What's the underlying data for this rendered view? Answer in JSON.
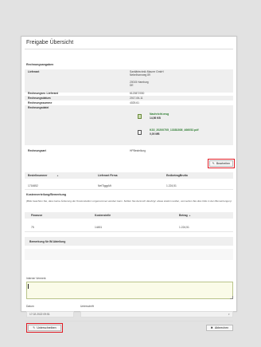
{
  "page": {
    "title": "Freigabe Übersicht"
  },
  "rechnungsangaben": {
    "heading": "Rechnungsangaben",
    "lieferant_label": "Lieferant",
    "lieferant_name": "Sanitärtechnik Maurer GmbH",
    "lieferant_street": "Nebelhornweg 89",
    "lieferant_city": "20015 Hamburg",
    "lieferant_country": "DE",
    "rechnungsnr_label": "Rechnungsnr. Lieferant",
    "rechnungsnr_value": "6123872030",
    "rechnungsdatum_label": "Rechnungsdatum",
    "rechnungsdatum_value": "2017-06-11",
    "rechnungssumme_label": "Rechnungssumme",
    "rechnungssumme_value": "4025.61",
    "dateien_label": "Rechnungsdatei",
    "file1_name": "Nachricht.msg",
    "file1_size": "14,56 KB",
    "file2_name": "K33_20200705_13381808_466052.pdf",
    "file2_size": "0,00 MB",
    "rechnungsart_label": "Rechnungsart",
    "rechnungsart_value": "HPBestellung"
  },
  "edit_button": "Bearbeiten",
  "bestell_table": {
    "headers": [
      "Bestellnummer",
      "Lieferant Firma",
      "EndbetragBrutto"
    ],
    "row": [
      "1716652",
      "NetTiggyMt",
      "1.224,51"
    ]
  },
  "kosten": {
    "heading": "Kostenverteilung/Bemerkung",
    "hint": "(Bitte beachten Sie, dass keine Änderung der Kostenstellen vorgenommen werden kann. Sollten Sie dennoch diesbzgl. etwas ändern wollen, vermerken Sie dies bitte in den Bemerkungen)",
    "headers": [
      "Finanzor",
      "Kostenstelle",
      "Betrag"
    ],
    "row": [
      "75",
      "14451",
      "1.224,51"
    ]
  },
  "bemerkung": {
    "label": "Bemerkung für IM Abteilung"
  },
  "interner_vermerk": {
    "label": "Interner Vermerk"
  },
  "datum": {
    "label": "Datum",
    "value": "17.02.2022 09:51"
  },
  "unterschrift": {
    "label": "Unterschrift"
  },
  "footer": {
    "sign_button": "Unterschreiben",
    "cancel_button": "Abbrechen"
  },
  "colors": {
    "highlight": "#e01b24",
    "file_link": "#2e7d32",
    "textarea_bg": "#fafbe8"
  }
}
